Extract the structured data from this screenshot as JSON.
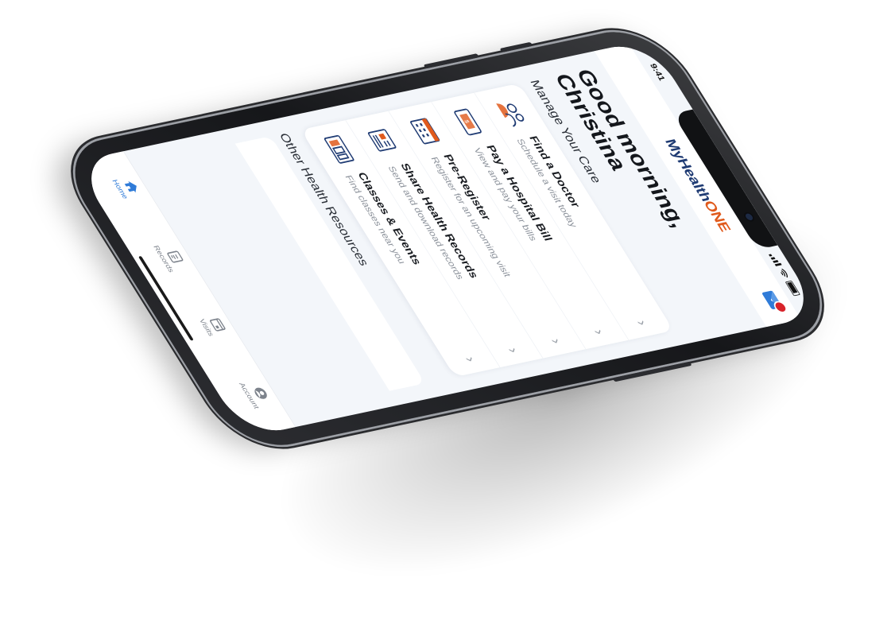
{
  "status_bar": {
    "time": "9:41"
  },
  "header": {
    "logo_primary": "MyHealth",
    "logo_accent": "ONE",
    "inbox_icon": "mail-icon"
  },
  "greeting": "Good morning, Christina",
  "manage_care": {
    "title": "Manage Your Care",
    "items": [
      {
        "title": "Find a Doctor",
        "subtitle": "Schedule a visit today",
        "icon": "doctors-icon"
      },
      {
        "title": "Pay a Hospital Bill",
        "subtitle": "View and pay your bills",
        "icon": "bill-icon"
      },
      {
        "title": "Pre-Register",
        "subtitle": "Register for an upcoming visit",
        "icon": "calendar-icon"
      },
      {
        "title": "Share Health Records",
        "subtitle": "Send and download records",
        "icon": "records-icon"
      },
      {
        "title": "Classes & Events",
        "subtitle": "Find classes near you",
        "icon": "classes-icon"
      }
    ]
  },
  "other_resources": {
    "title": "Other Health Resources"
  },
  "tabbar": {
    "tabs": [
      {
        "label": "Home",
        "icon": "home-icon",
        "active": true
      },
      {
        "label": "Records",
        "icon": "clipboard-icon",
        "active": false
      },
      {
        "label": "Visits",
        "icon": "calendar-icon",
        "active": false
      },
      {
        "label": "Account",
        "icon": "account-icon",
        "active": false
      }
    ]
  },
  "colors": {
    "brand_navy": "#1f3b73",
    "brand_orange": "#e05a1c",
    "accent_blue": "#2f7bd8",
    "badge_red": "#d8232a"
  }
}
